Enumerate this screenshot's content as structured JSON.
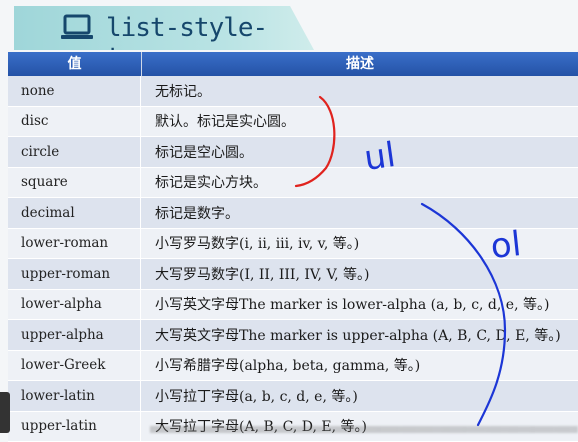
{
  "title": "list-style-type",
  "table": {
    "headers": {
      "value": "值",
      "description": "描述"
    },
    "rows": [
      {
        "value": "none",
        "description": "无标记。"
      },
      {
        "value": "disc",
        "description": "默认。标记是实心圆。"
      },
      {
        "value": "circle",
        "description": "标记是空心圆。"
      },
      {
        "value": "square",
        "description": "标记是实心方块。"
      },
      {
        "value": "decimal",
        "description": "标记是数字。"
      },
      {
        "value": "lower-roman",
        "description": "小写罗马数字(i, ii, iii, iv, v, 等。)"
      },
      {
        "value": "upper-roman",
        "description": "大写罗马数字(I, II, III, IV, V, 等。)"
      },
      {
        "value": "lower-alpha",
        "description": "小写英文字母The marker is lower-alpha (a, b, c, d, e, 等。)"
      },
      {
        "value": "upper-alpha",
        "description": "大写英文字母The marker is upper-alpha (A, B, C, D, E, 等。)"
      },
      {
        "value": "lower-Greek",
        "description": "小写希腊字母(alpha, beta, gamma, 等。)"
      },
      {
        "value": "lower-latin",
        "description": "小写拉丁字母(a, b, c, d, e, 等。)"
      },
      {
        "value": "upper-latin",
        "description": "大写拉丁字母(A, B, C, D, E, 等。)"
      }
    ]
  },
  "annotations": {
    "ul_label": "ul",
    "ol_label": "ol",
    "ul_color": "#e0231e",
    "ol_color": "#1c36d6"
  },
  "colors": {
    "header": "#2d5fb8",
    "banner": "#aedcdd",
    "title_text": "#16476c"
  }
}
